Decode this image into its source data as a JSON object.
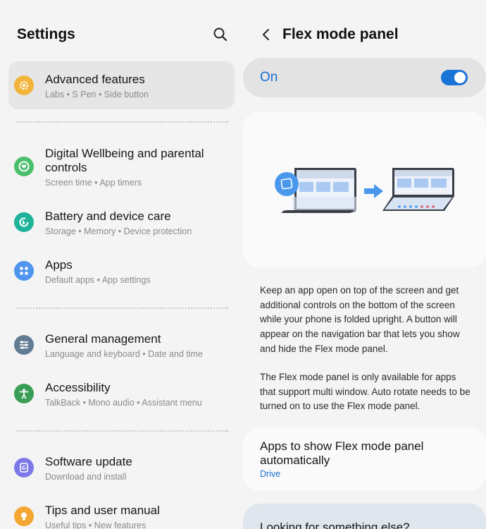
{
  "left": {
    "title": "Settings",
    "items": [
      {
        "title": "Advanced features",
        "sub": "Labs  •  S Pen  •  Side button",
        "icon": "gear-sparkle-icon",
        "color": "#f2b43c"
      },
      {
        "title": "Digital Wellbeing and parental controls",
        "sub": "Screen time  •  App timers",
        "icon": "heart-ring-icon",
        "color": "#4bbf6b"
      },
      {
        "title": "Battery and device care",
        "sub": "Storage  •  Memory  •  Device protection",
        "icon": "device-care-icon",
        "color": "#1fb39a"
      },
      {
        "title": "Apps",
        "sub": "Default apps  •  App settings",
        "icon": "apps-grid-icon",
        "color": "#4f95f0"
      },
      {
        "title": "General management",
        "sub": "Language and keyboard  •  Date and time",
        "icon": "sliders-icon",
        "color": "#637b93"
      },
      {
        "title": "Accessibility",
        "sub": "TalkBack  •  Mono audio  •  Assistant menu",
        "icon": "person-icon",
        "color": "#3a9e56"
      },
      {
        "title": "Software update",
        "sub": "Download and install",
        "icon": "update-icon",
        "color": "#7d78e8"
      },
      {
        "title": "Tips and user manual",
        "sub": "Useful tips  •  New features",
        "icon": "bulb-icon",
        "color": "#f3a732"
      }
    ]
  },
  "right": {
    "title": "Flex mode panel",
    "switch_label": "On",
    "switch_on": true,
    "accent": "#1a6fd1",
    "description_1": "Keep an app open on top of the screen and get additional controls on the bottom of the screen while your phone is folded upright. A button will appear on the navigation bar that lets you show and hide the Flex mode panel.",
    "description_2": "The Flex mode panel is only available for apps that support multi window. Auto rotate needs to be turned on to use the Flex mode panel.",
    "apps_title": "Apps to show Flex mode panel automatically",
    "apps_value": "Drive",
    "looking_title": "Looking for something else?"
  }
}
